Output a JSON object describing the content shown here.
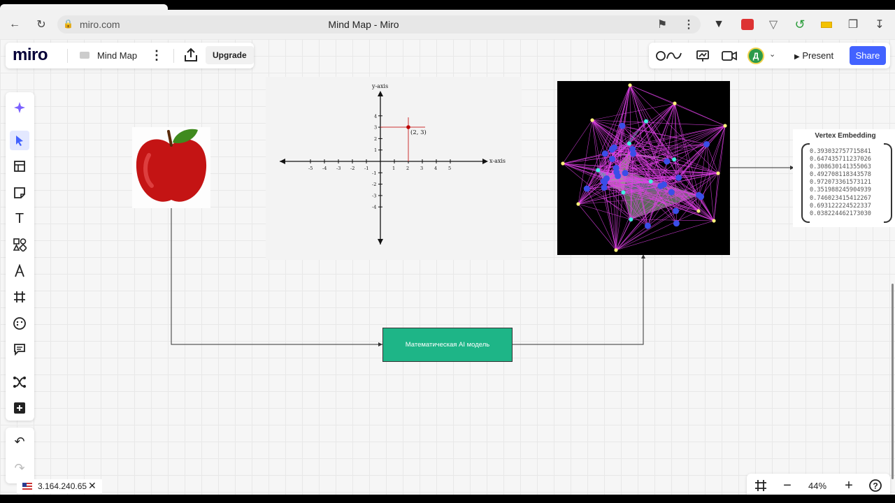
{
  "browser": {
    "url": "miro.com",
    "page_title": "Mind Map - Miro"
  },
  "header": {
    "logo": "miro",
    "board_name": "Mind Map",
    "upgrade_label": "Upgrade",
    "present_label": "Present",
    "share_label": "Share",
    "avatar_initial": "Д"
  },
  "toolbar": {
    "tools": [
      "ai-sparkle",
      "select",
      "templates",
      "sticky-note",
      "text",
      "shapes",
      "pen",
      "frame",
      "stickers",
      "comment",
      "mind-map",
      "more"
    ],
    "active_tool": "select"
  },
  "canvas": {
    "graph": {
      "y_axis_label": "y-axis",
      "x_axis_label": "x-axis",
      "point_label": "(2, 3)",
      "x_ticks": [
        "-5",
        "-4",
        "-3",
        "-2",
        "-1",
        "1",
        "2",
        "3",
        "4",
        "5"
      ],
      "y_ticks": [
        "4",
        "3",
        "2",
        "1",
        "-1",
        "-2",
        "-3",
        "-4"
      ]
    },
    "vertex_embedding": {
      "title": "Vertex Embedding",
      "values": [
        "0.393032757715841",
        "0.647435711237026",
        "0.308630141355063",
        "0.492708118343578",
        "0.972073361573121",
        "0.351988245904939",
        "0.746023415412267",
        "0.693122224522337",
        "0.038224462173030"
      ]
    },
    "model_box_label": "Математическая AI модель",
    "model_box_color": "#1eb587"
  },
  "footer": {
    "ip_address": "3.164.240.65",
    "zoom_level": "44%"
  },
  "colors": {
    "accent": "#4262ff",
    "miro_dark": "#050038"
  }
}
